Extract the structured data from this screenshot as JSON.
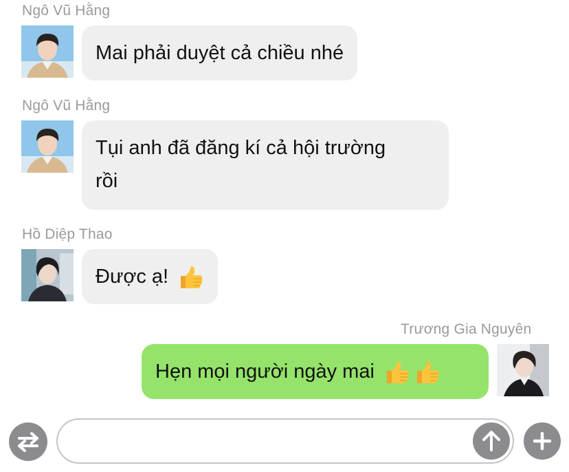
{
  "messages": [
    {
      "sender": "Ngô Vũ Hằng",
      "text": "Mai phải duyệt cả chiều nhé",
      "avatar": "boy-avatar",
      "direction": "incoming"
    },
    {
      "sender": "Ngô Vũ Hằng",
      "text_line1": "Tụi anh đã đăng kí cả hội trường",
      "text_line2": "rồi",
      "avatar": "boy-avatar",
      "direction": "incoming"
    },
    {
      "sender": "Hồ Diệp Thao",
      "text": "Được ạ!",
      "emoji": "thumbs-up",
      "avatar": "girl-avatar",
      "direction": "incoming"
    },
    {
      "sender": "Trương Gia Nguyên",
      "text": "Hẹn mọi người ngày mai",
      "emoji": "thumbs-up thumbs-up",
      "avatar": "boy2-avatar",
      "direction": "outgoing"
    }
  ],
  "composer": {
    "placeholder": "",
    "left_icon": "swap-arrows-icon",
    "send_icon": "arrow-up-icon",
    "add_icon": "plus-icon"
  },
  "colors": {
    "incoming_bubble": "#efefef",
    "outgoing_bubble": "#95e36b",
    "sender_text": "#9a9a9a",
    "button_gray": "#8c8c90"
  }
}
